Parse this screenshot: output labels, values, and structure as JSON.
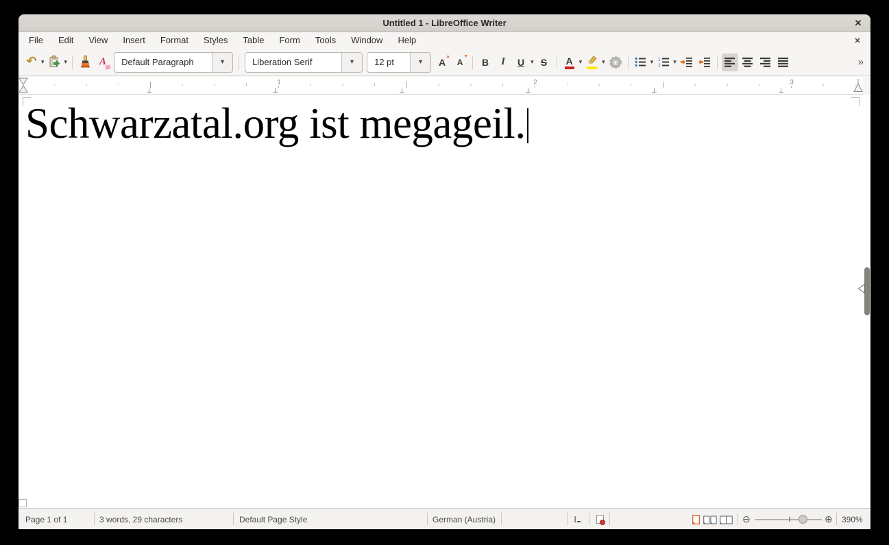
{
  "window": {
    "title": "Untitled 1 - LibreOffice Writer",
    "close_icon": "✕"
  },
  "menubar": {
    "items": [
      "File",
      "Edit",
      "View",
      "Insert",
      "Format",
      "Styles",
      "Table",
      "Form",
      "Tools",
      "Window",
      "Help"
    ],
    "close_icon": "✕"
  },
  "toolbar": {
    "undo_icon": "↶",
    "dropdown_icon": "▾",
    "paragraph_style": "Default Paragraph",
    "font_name": "Liberation Serif",
    "font_size": "12 pt",
    "grow_label": "A",
    "shrink_label": "A",
    "grow_arrow": "▲",
    "shrink_arrow": "▼",
    "bold_label": "B",
    "italic_label": "I",
    "underline_label": "U",
    "strikethrough_label": "S",
    "font_color_label": "A",
    "clear_format_label": "A",
    "overflow_icon": "»",
    "accent_font_color": "#c9211e",
    "accent_highlight": "#ffe900"
  },
  "ruler": {
    "numbers": [
      "1",
      "2",
      "3"
    ]
  },
  "document": {
    "text": "Schwarzatal.org ist megageil."
  },
  "statusbar": {
    "page_info": "Page 1 of 1",
    "word_count": "3 words, 29 characters",
    "page_style": "Default Page Style",
    "language": "German (Austria)",
    "insert_icon": "I",
    "zoom_out_icon": "⊖",
    "zoom_in_icon": "⊕",
    "zoom_level": "390%"
  }
}
